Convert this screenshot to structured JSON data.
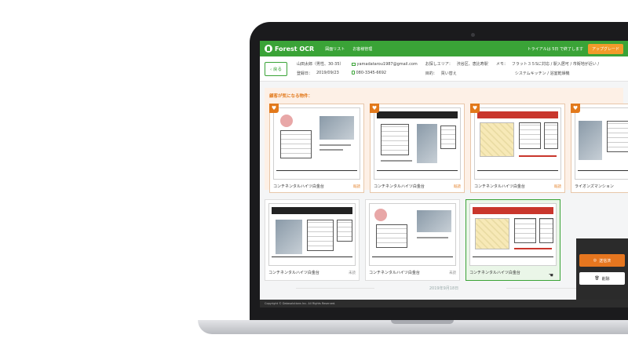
{
  "header": {
    "brand": "Forest OCR",
    "nav": [
      "図面リスト",
      "お客様管理"
    ],
    "trial_notice": "トライアルは 5日 で終了します",
    "upgrade_label": "アップグレード"
  },
  "customer": {
    "back_label": "戻る",
    "name": "山田太郎（男性、30-35）",
    "registered_label": "登録日：",
    "registered_date": "2019/09/23",
    "email": "yamadatarou1987@gmail.com",
    "phone": "080-3345-6692",
    "area_label": "お探しエリア：",
    "area_value": "渋谷区、恵比寿駅",
    "purpose_label": "目的：",
    "purpose_value": "買い替え",
    "memo_label": "メモ：",
    "memo_line1": "フラット３５Sに対応 / 駅入居可 / 市街地が近い /",
    "memo_line2": "システムキッチン / 浴室乾燥機"
  },
  "favorites": {
    "title": "顧客が気になる物件：",
    "items": [
      {
        "name": "コンチネンタルハイツ白金台",
        "tag": "既読"
      },
      {
        "name": "コンチネンタルハイツ白金台",
        "tag": "既読"
      },
      {
        "name": "コンチネンタルハイツ白金台",
        "tag": "既読"
      },
      {
        "name": "ライオンズマンション"
      }
    ]
  },
  "listings": {
    "items": [
      {
        "name": "コンチネンタルハイツ白金台",
        "tag": "未読"
      },
      {
        "name": "コンチネンタルハイツ白金台",
        "tag": "未読"
      },
      {
        "name": "コンチネンタルハイツ白金台"
      }
    ],
    "date": "2019年9月18日"
  },
  "panel": {
    "primary_label": "送信済",
    "secondary_label": "削除"
  },
  "footer": {
    "copyright": "Copyright © Datasolutions Inc. All Rights Reserved."
  },
  "colors": {
    "brand_green": "#3aa337",
    "accent_orange": "#e2791b",
    "favorite_bg": "#fdf0e6"
  }
}
